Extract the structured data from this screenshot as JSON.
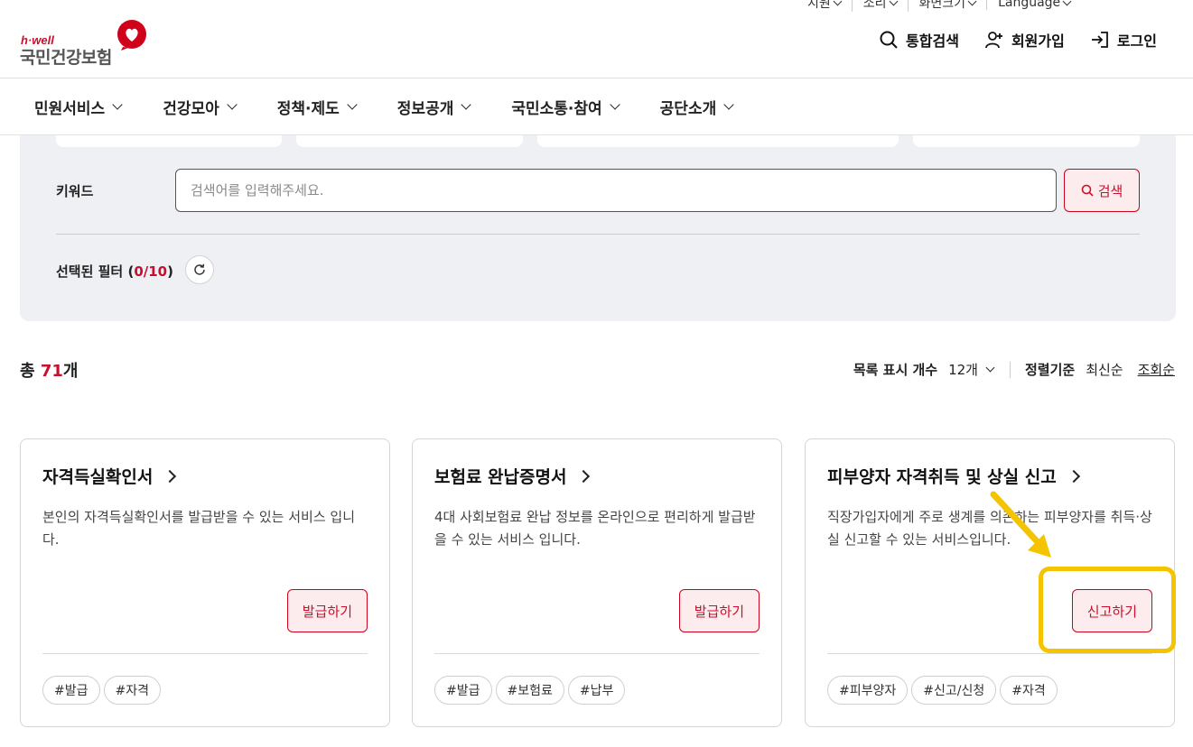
{
  "utility": [
    "지원",
    "소리",
    "화면크기",
    "Language"
  ],
  "logo": {
    "tagline": "h·well",
    "name": "국민건강보험"
  },
  "header_actions": {
    "search": "통합검색",
    "signup": "회원가입",
    "login": "로그인"
  },
  "gnb": [
    "민원서비스",
    "건강모아",
    "정책·제도",
    "정보공개",
    "국민소통·참여",
    "공단소개"
  ],
  "search": {
    "keyword_label": "키워드",
    "placeholder": "검색어를 입력해주세요.",
    "button_label": "검색",
    "filter_label_prefix": "선택된 필터 (",
    "filter_count": "0/10",
    "filter_label_suffix": ")"
  },
  "results": {
    "total_prefix": "총 ",
    "total_count": "71",
    "total_suffix": "개",
    "per_page_label": "목록 표시 개수",
    "per_page_value": "12개",
    "sort_label": "정렬기준",
    "sort_latest": "최신순",
    "sort_views": "조회순"
  },
  "cards": [
    {
      "title": "자격득실확인서",
      "desc": "본인의 자격득실확인서를 발급받을 수 있는 서비스 입니다.",
      "action": "발급하기",
      "tags": [
        "#발급",
        "#자격"
      ]
    },
    {
      "title": "보험료 완납증명서",
      "desc": "4대 사회보험료 완납 정보를 온라인으로 편리하게 발급받을 수 있는 서비스 입니다.",
      "action": "발급하기",
      "tags": [
        "#발급",
        "#보험료",
        "#납부"
      ]
    },
    {
      "title": "피부양자 자격취득 및 상실 신고",
      "desc": "직장가입자에게 주로 생계를 의존하는 피부양자를 취득·상실 신고할 수 있는 서비스입니다.",
      "action": "신고하기",
      "tags": [
        "#피부양자",
        "#신고/신청",
        "#자격"
      ]
    }
  ],
  "colors": {
    "accent": "#c8102e",
    "highlight": "#f5c400",
    "panel_bg": "#eef0f4"
  }
}
